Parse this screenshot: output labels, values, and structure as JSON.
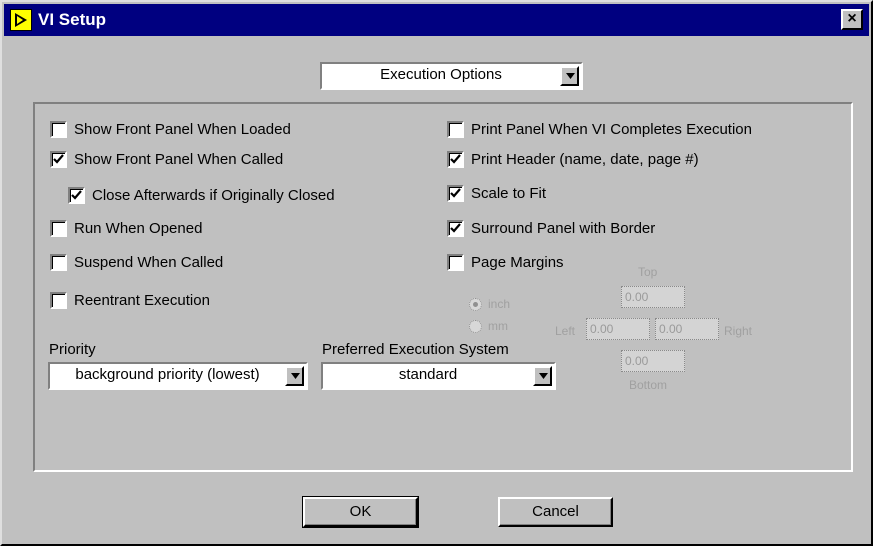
{
  "window": {
    "title": "VI Setup",
    "close_glyph": "×",
    "icon": "labview-run-icon",
    "colors": {
      "titlebar": "#000080",
      "face": "#c0c0c0"
    }
  },
  "options_ring": {
    "selected": "Execution Options"
  },
  "left_options": [
    {
      "label": "Show Front Panel When Loaded",
      "checked": false
    },
    {
      "label": "Show Front Panel When Called",
      "checked": true
    },
    {
      "label": "Close Afterwards if Originally Closed",
      "checked": true
    },
    {
      "label": "Run When Opened",
      "checked": false
    },
    {
      "label": "Suspend When Called",
      "checked": false
    },
    {
      "label": "Reentrant Execution",
      "checked": false
    }
  ],
  "right_options": [
    {
      "label": "Print Panel When VI Completes Execution",
      "checked": false
    },
    {
      "label": "Print Header (name, date, page #)",
      "checked": true
    },
    {
      "label": "Scale to Fit",
      "checked": true
    },
    {
      "label": "Surround Panel with Border",
      "checked": true
    },
    {
      "label": "Page Margins",
      "checked": false
    }
  ],
  "priority": {
    "label": "Priority",
    "value": "background priority (lowest)"
  },
  "execution_system": {
    "label": "Preferred Execution System",
    "value": "standard"
  },
  "page_margins": {
    "units": [
      {
        "label": "inch",
        "selected": true
      },
      {
        "label": "mm",
        "selected": false
      }
    ],
    "top_label": "Top",
    "bottom_label": "Bottom",
    "left_label": "Left",
    "right_label": "Right",
    "top": "0.00",
    "bottom": "0.00",
    "left": "0.00",
    "right": "0.00",
    "enabled": false
  },
  "buttons": {
    "ok": "OK",
    "cancel": "Cancel"
  }
}
